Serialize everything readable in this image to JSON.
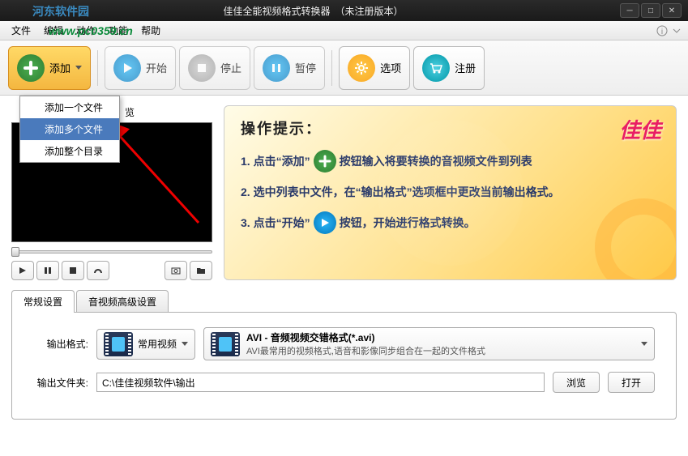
{
  "window": {
    "title": "佳佳全能视频格式转换器　（未注册版本）",
    "watermark_site": "河东软件园",
    "watermark_url": "www.pc0359.cn"
  },
  "menubar": {
    "items": [
      "文件",
      "编辑",
      "动作",
      "功能",
      "帮助"
    ]
  },
  "toolbar": {
    "add": "添加",
    "start": "开始",
    "stop": "停止",
    "pause": "暂停",
    "options": "选项",
    "register": "注册"
  },
  "dropdown": {
    "add_single": "添加一个文件",
    "add_multiple": "添加多个文件",
    "add_folder": "添加整个目录"
  },
  "preview": {
    "label": "览"
  },
  "tips": {
    "heading": "操作提示：",
    "line1_a": "1. 点击“添加”",
    "line1_b": "按钮输入将要转换的音视频文件到列表",
    "line2": "2. 选中列表中文件，在“输出格式”选项框中更改当前输出格式。",
    "line3_a": "3. 点击“开始”",
    "line3_b": "按钮，开始进行格式转换。",
    "brand": "佳佳"
  },
  "settings": {
    "tab_general": "常规设置",
    "tab_advanced": "音视频高级设置",
    "output_format_label": "输出格式:",
    "category": "常用视频",
    "format_title": "AVI - 音频视频交错格式(*.avi)",
    "format_desc": "AVI最常用的视频格式,语音和影像同步组合在一起的文件格式",
    "output_folder_label": "输出文件夹:",
    "output_path": "C:\\佳佳视频软件\\输出",
    "browse": "浏览",
    "open": "打开"
  }
}
